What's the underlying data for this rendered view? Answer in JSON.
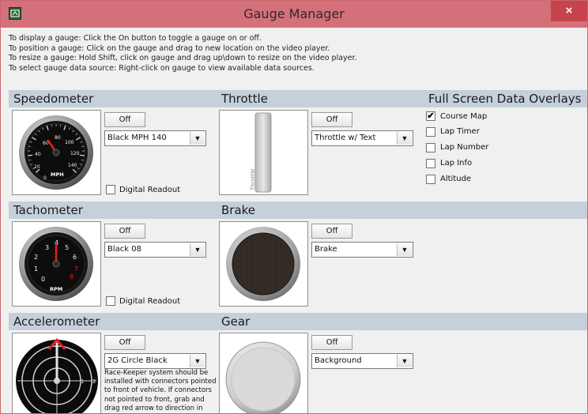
{
  "window": {
    "title": "Gauge Manager",
    "close_glyph": "×",
    "accent_color": "#d4707a",
    "section_color": "#c5d0db"
  },
  "instructions": [
    "To display a gauge: Click the On button to toggle a gauge on or off.",
    "To position a gauge: Click on the gauge and drag to new location on the video player.",
    "To resize a gauge: Hold Shift, click on gauge and drag up\\down to resize on the video player.",
    "To select gauge data source: Right-click on gauge to view available data sources."
  ],
  "sections": {
    "speedometer": {
      "title": "Speedometer",
      "toggle_label": "Off",
      "selected": "Black MPH 140",
      "digital_readout_label": "Digital Readout",
      "digital_readout_checked": false,
      "dial_labels": [
        "0",
        "20",
        "40",
        "60",
        "80",
        "100",
        "120",
        "140"
      ],
      "unit": "MPH"
    },
    "throttle": {
      "title": "Throttle",
      "toggle_label": "Off",
      "selected": "Throttle w/ Text",
      "bar_text": "Throttle"
    },
    "overlays": {
      "title": "Full Screen Data Overlays",
      "items": [
        {
          "label": "Course Map",
          "checked": true
        },
        {
          "label": "Lap Timer",
          "checked": false
        },
        {
          "label": "Lap Number",
          "checked": false
        },
        {
          "label": "Lap Info",
          "checked": false
        },
        {
          "label": "Altitude",
          "checked": false
        }
      ]
    },
    "tachometer": {
      "title": "Tachometer",
      "toggle_label": "Off",
      "selected": "Black 08",
      "digital_readout_label": "Digital Readout",
      "digital_readout_checked": false,
      "dial_labels": [
        "0",
        "1",
        "2",
        "3",
        "4",
        "5",
        "6",
        "7",
        "8"
      ],
      "unit": "RPM"
    },
    "brake": {
      "title": "Brake",
      "toggle_label": "Off",
      "selected": "Brake"
    },
    "accelerometer": {
      "title": "Accelerometer",
      "toggle_label": "Off",
      "selected": "2G Circle Black",
      "ring_labels": [
        "1",
        "2"
      ],
      "note_lines": [
        "Race-Keeper system should be",
        "installed with connectors pointed",
        "to front of vehicle.  If connectors",
        "not pointed to front, grab and",
        "drag red arrow to direction in"
      ]
    },
    "gear": {
      "title": "Gear",
      "toggle_label": "Off",
      "selected": "Background"
    }
  }
}
